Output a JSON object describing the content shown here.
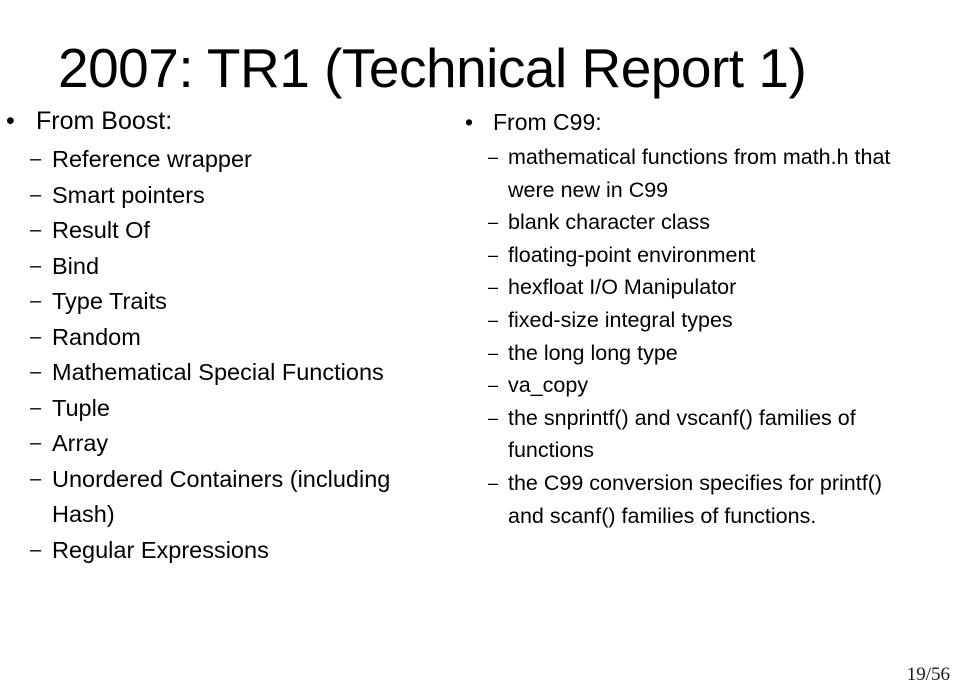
{
  "slide": {
    "title": "2007: TR1 (Technical Report 1)",
    "page_number": "19/56",
    "bullet_glyph": "•",
    "dash_glyph": "–",
    "text_color": "#000000",
    "background_color": "#ffffff"
  },
  "left_column": {
    "heading": "From Boost:",
    "items": [
      {
        "label": "Reference wrapper"
      },
      {
        "label": "Smart pointers"
      },
      {
        "label": "Result Of"
      },
      {
        "label": "Bind"
      },
      {
        "label": "Type Traits"
      },
      {
        "label": "Random"
      },
      {
        "label": "Mathematical Special Functions"
      },
      {
        "label": "Tuple"
      },
      {
        "label": "Array"
      },
      {
        "label": "Unordered Containers (including Hash)"
      },
      {
        "label": "Regular Expressions"
      }
    ]
  },
  "right_column": {
    "heading": "From C99:",
    "items": [
      {
        "label": "mathematical functions from math.h that were new in C99"
      },
      {
        "label": "blank character class"
      },
      {
        "label": "floating-point environment"
      },
      {
        "label": "hexfloat I/O Manipulator"
      },
      {
        "label": "fixed-size integral types"
      },
      {
        "label": "the long long type"
      },
      {
        "label": "va_copy"
      },
      {
        "label": "the snprintf() and vscanf() families of functions"
      },
      {
        "label": "the C99 conversion specifies for printf() and scanf() families of functions."
      }
    ]
  }
}
